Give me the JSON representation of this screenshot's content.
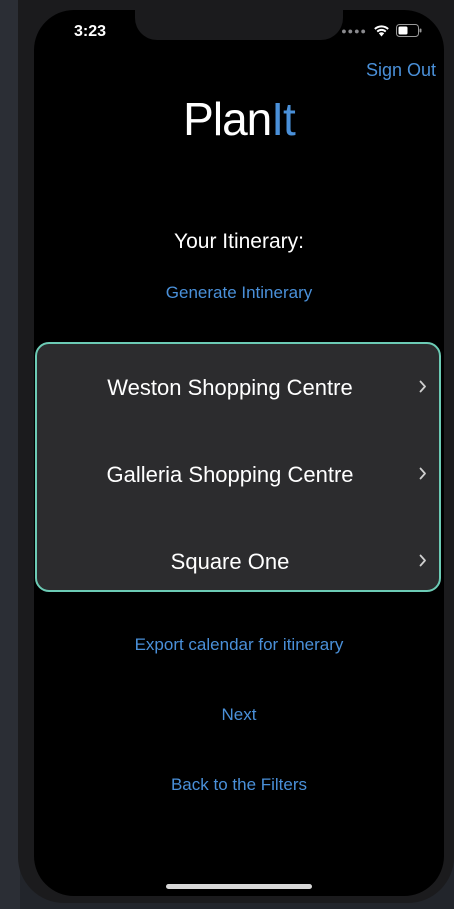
{
  "status_bar": {
    "time": "3:23"
  },
  "header": {
    "sign_out_label": "Sign Out",
    "logo_part1": "Plan",
    "logo_part2": "It"
  },
  "itinerary": {
    "title": "Your Itinerary:",
    "generate_label": "Generate Intinerary",
    "items": [
      {
        "label": "Weston Shopping Centre"
      },
      {
        "label": "Galleria Shopping Centre"
      },
      {
        "label": "Square One"
      }
    ]
  },
  "actions": {
    "export_label": "Export calendar for itinerary",
    "next_label": "Next",
    "back_label": "Back to the Filters"
  },
  "colors": {
    "accent": "#4a90d9",
    "list_border": "#6ccbb5",
    "list_background": "#2c2c2e",
    "screen_background": "#000000"
  },
  "icons": {
    "status": [
      "cellular-signal-icon",
      "wifi-icon",
      "battery-icon"
    ],
    "list": "chevron-right-icon"
  }
}
